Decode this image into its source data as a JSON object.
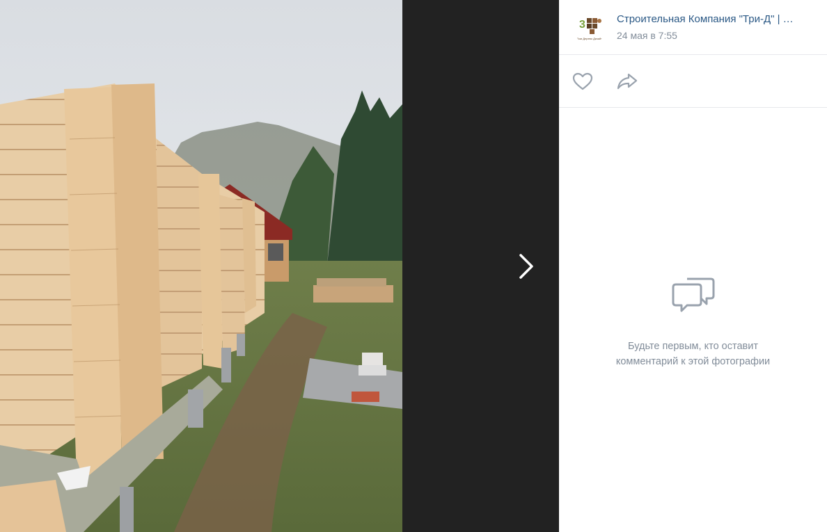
{
  "post": {
    "author": "Строительная Компания \"Три-Д\" | …",
    "date": "24 мая в 7:55",
    "avatar_text": "Дом Дерево Дизайн"
  },
  "actions": {
    "like_icon": "heart-icon",
    "share_icon": "share-icon"
  },
  "navigation": {
    "next_icon": "chevron-right-icon"
  },
  "comments": {
    "empty_line1": "Будьте первым, кто оставит",
    "empty_line2": "комментарий к этой фотографии",
    "empty_icon": "comments-icon"
  },
  "colors": {
    "viewer_bg": "#222222",
    "link": "#2a5885",
    "muted": "#818c99",
    "icon": "#99a2ad"
  }
}
